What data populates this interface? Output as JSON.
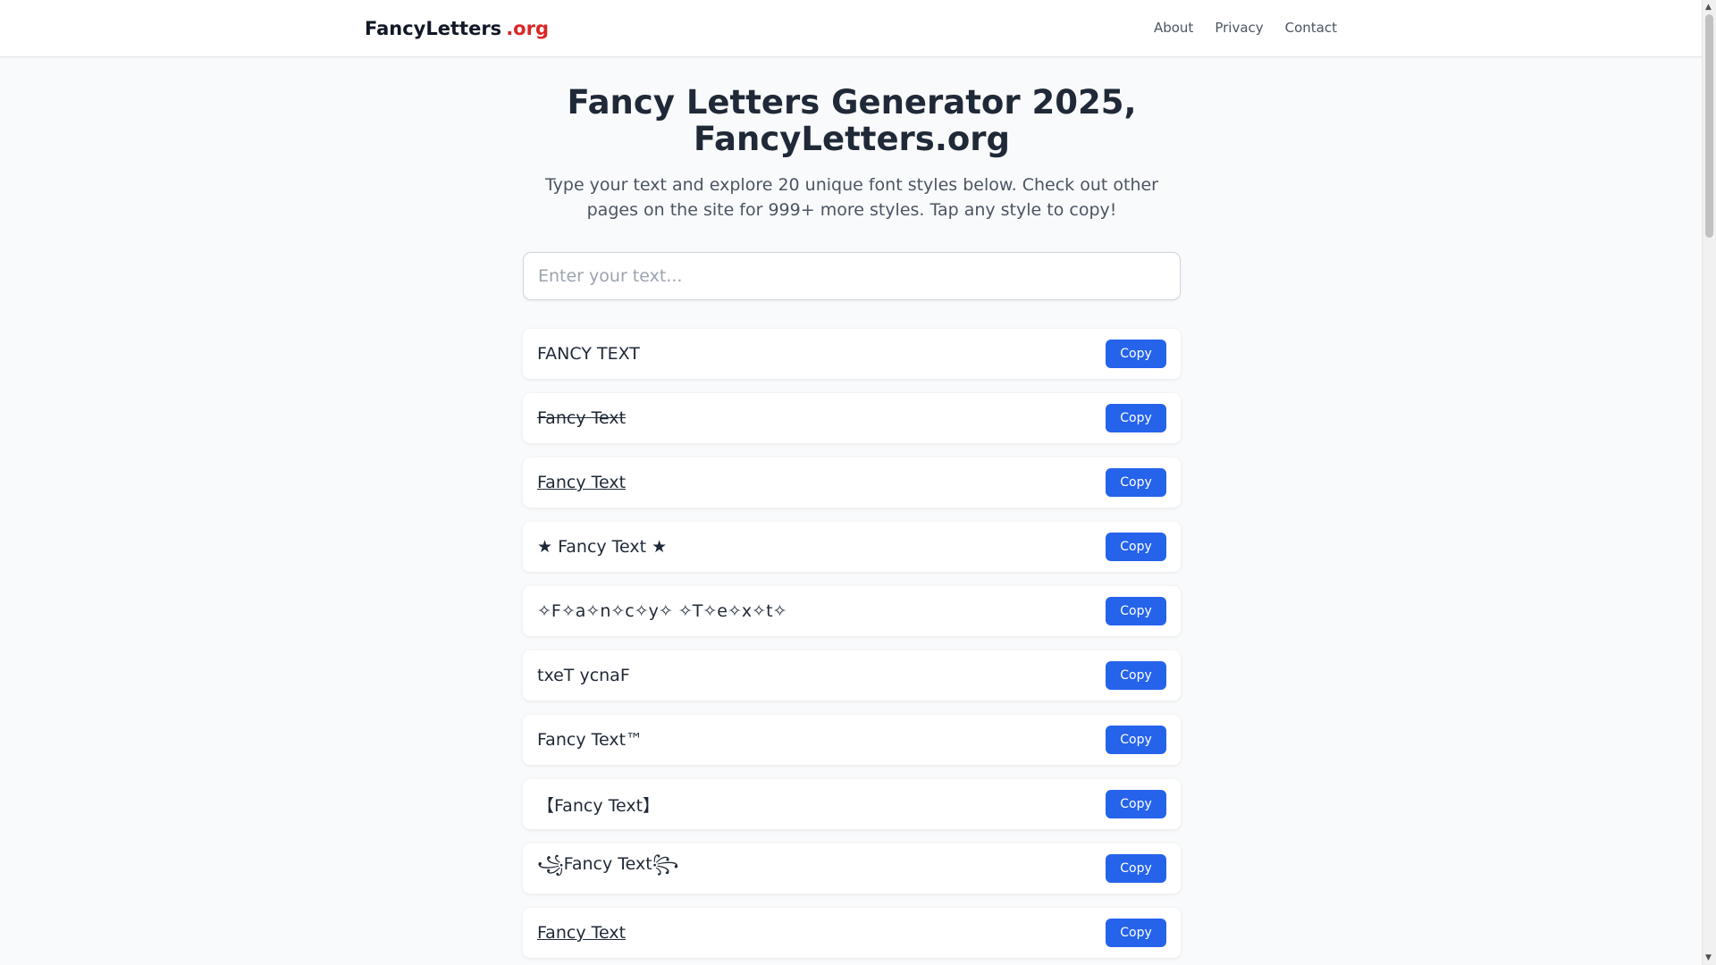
{
  "header": {
    "brand_name": "FancyLetters",
    "brand_tld": ".org",
    "nav": [
      "About",
      "Privacy",
      "Contact"
    ]
  },
  "main": {
    "title": "Fancy Letters Generator 2025, FancyLetters.org",
    "subtitle": "Type your text and explore 20 unique font styles below. Check out other pages on the site for 999+ more styles. Tap any style to copy!",
    "input_placeholder": "Enter your text...",
    "input_value": ""
  },
  "styles": [
    {
      "text": "FANCY TEXT",
      "copy_label": "Copy"
    },
    {
      "text": "Fancy Text",
      "copy_label": "Copy"
    },
    {
      "text": "Fancy Text ",
      "copy_label": "Copy"
    },
    {
      "text": "★ Fancy Text ★",
      "copy_label": "Copy"
    },
    {
      "text": "✧F✧a✧n✧c✧y✧ ✧T✧e✧x✧t✧",
      "copy_label": "Copy"
    },
    {
      "text": "txeT ycnaF",
      "copy_label": "Copy"
    },
    {
      "text": "Fancy Text™",
      "copy_label": "Copy"
    },
    {
      "text": "【Fancy Text】",
      "copy_label": "Copy"
    },
    {
      "text": "꧁Fancy Text꧂",
      "copy_label": "Copy"
    },
    {
      "text": "Fancy Text ",
      "copy_label": "Copy"
    }
  ],
  "colors": {
    "accent": "#2563eb",
    "brand_tld": "#dc2626",
    "text": "#1f2937",
    "muted": "#4b5563"
  },
  "icons": {
    "scroll_up": "scroll-up-arrow-icon",
    "scroll_down": "scroll-down-arrow-icon"
  }
}
